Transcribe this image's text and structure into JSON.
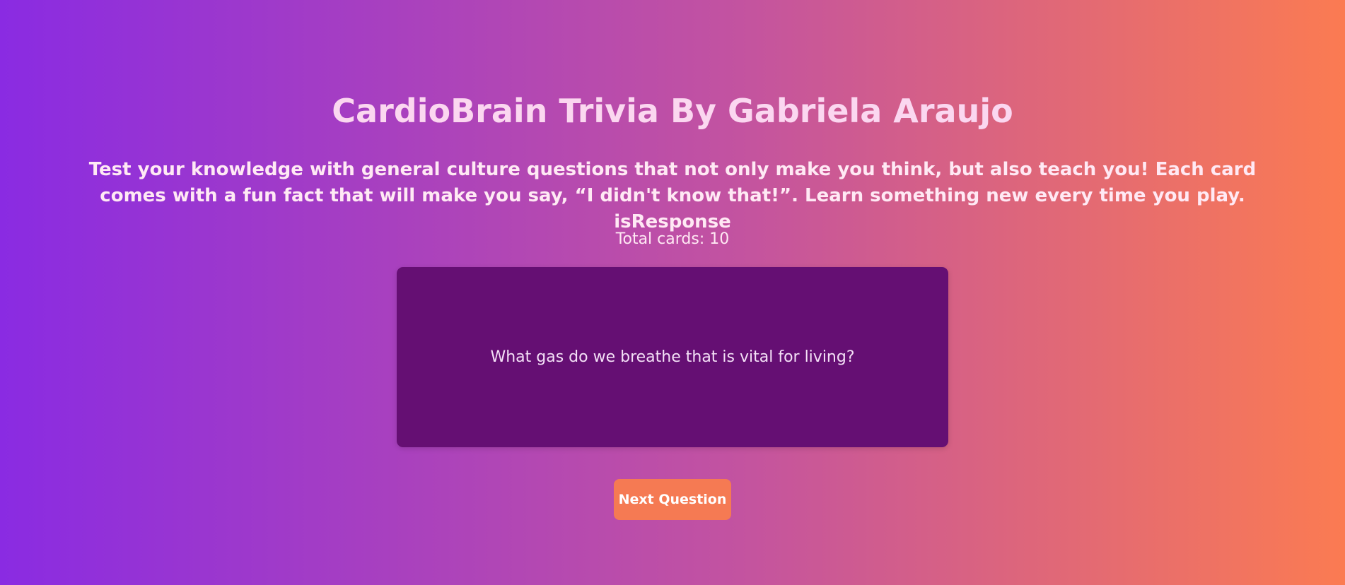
{
  "header": {
    "title": "CardioBrain Trivia By Gabriela Araujo",
    "subtitle": "Test your knowledge with general culture questions that not only make you think, but also teach you! Each card comes with a fun fact that will make you say, “I didn't know that!”. Learn something new every time you play. isResponse"
  },
  "stats": {
    "total_cards_text": "Total cards: 10"
  },
  "card": {
    "question": "What gas do we breathe that is vital for living?"
  },
  "actions": {
    "next_label": "Next Question"
  },
  "colors": {
    "gradient_start": "#8a2be2",
    "gradient_end": "#fb7b52",
    "card_bg": "#650f73",
    "button_bg": "#f57a53"
  }
}
